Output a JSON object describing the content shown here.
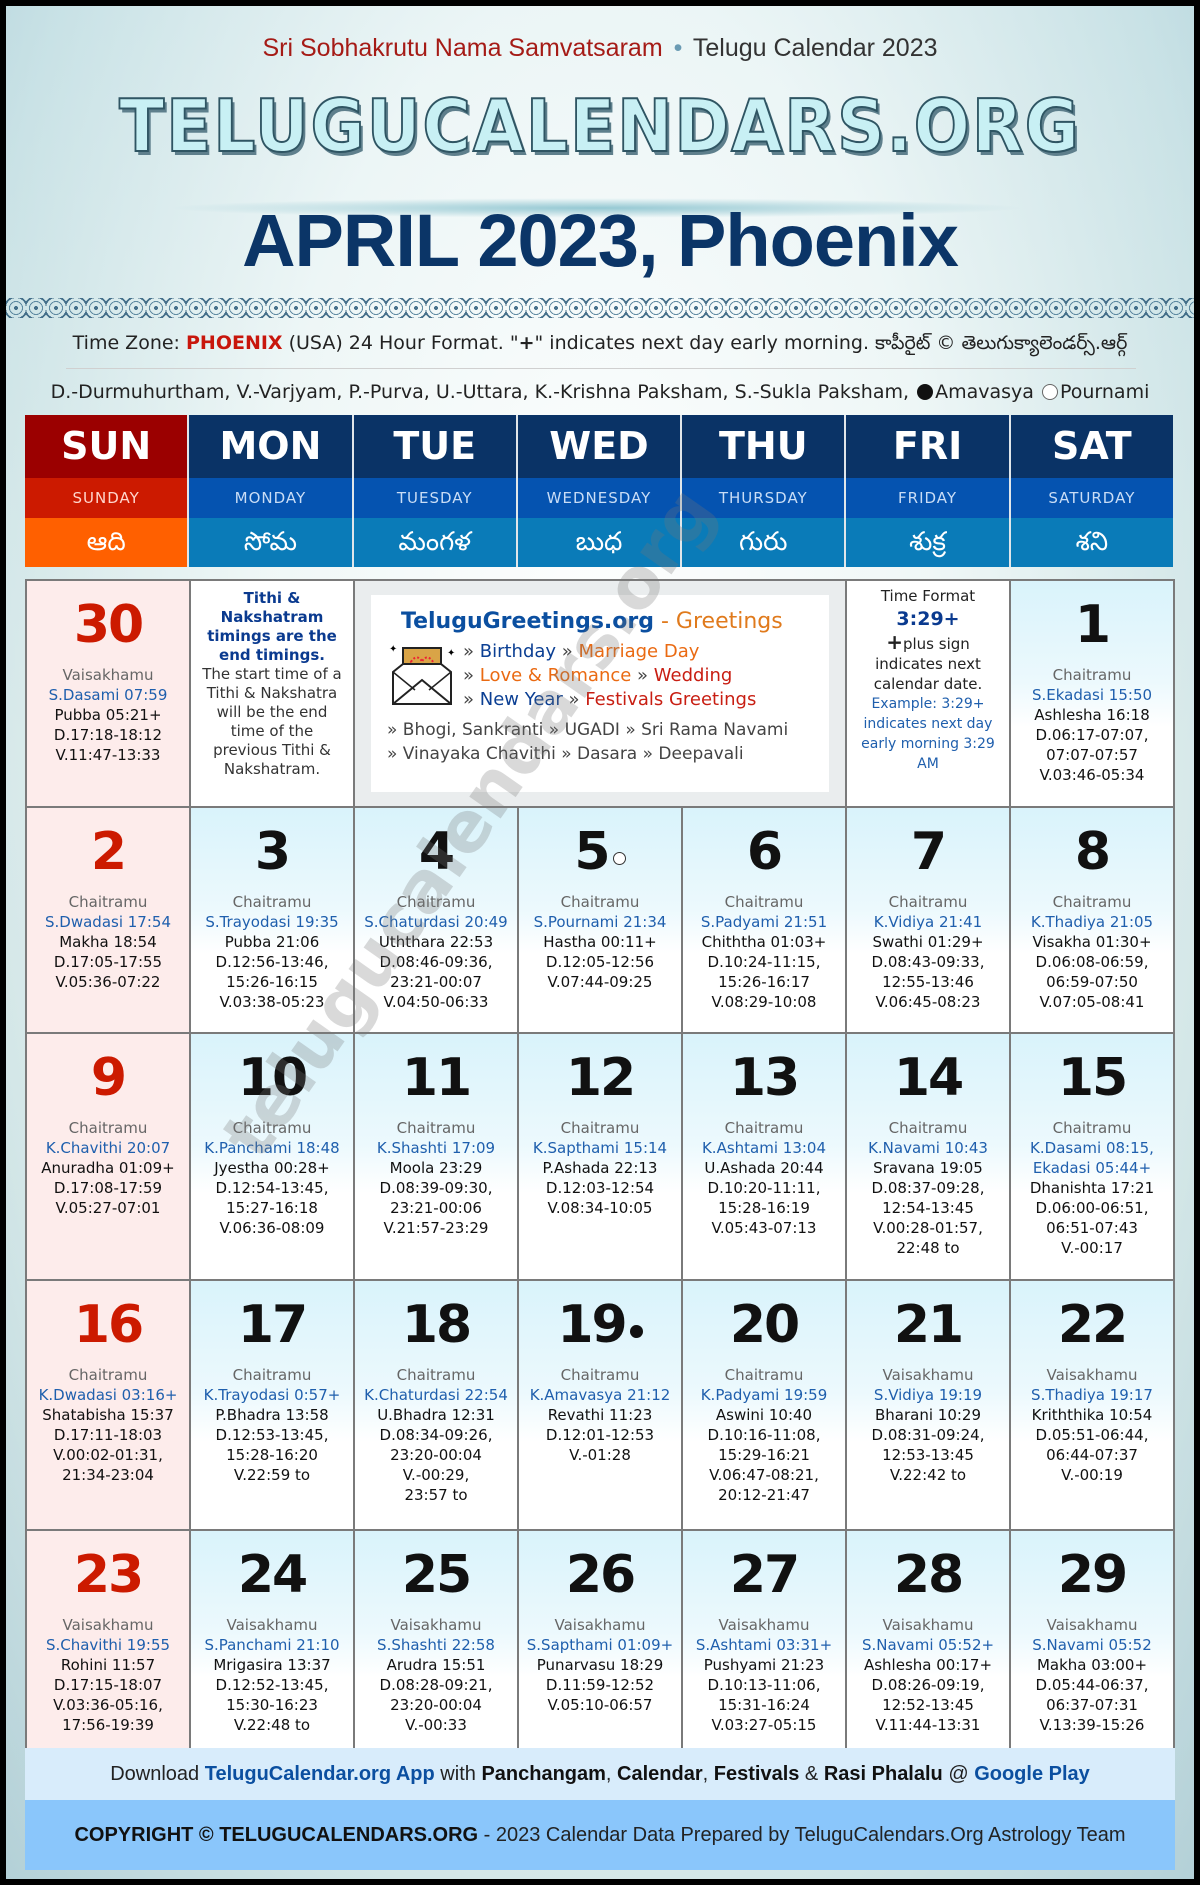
{
  "header": {
    "samvatsaram": "Sri Sobhakrutu Nama Samvatsaram",
    "separator": "•",
    "calendar_year_label": "Telugu Calendar 2023",
    "logo": "TELUGUCALENDARS.ORG",
    "title": "APRIL 2023, Phoenix"
  },
  "timezone": {
    "prefix": "Time Zone: ",
    "city": "PHOENIX",
    "suffix_1": " (USA) 24 Hour Format. \"",
    "plus": "+",
    "suffix_2": "\" indicates next day early morning. కాపీరైట్ © తెలుగుక్యాలెండర్స్.ఆర్గ్"
  },
  "legend": {
    "text": "D.-Durmuhurtham, V.-Varjyam, P.-Purva, U.-Uttara, K.-Krishna Paksham, S.-Sukla Paksham,",
    "amavasya": "Amavasya",
    "pournami": "Pournami"
  },
  "weekdays": [
    {
      "abbr": "SUN",
      "full": "SUNDAY",
      "telugu": "ఆది"
    },
    {
      "abbr": "MON",
      "full": "MONDAY",
      "telugu": "సోమ"
    },
    {
      "abbr": "TUE",
      "full": "TUESDAY",
      "telugu": "మంగళ"
    },
    {
      "abbr": "WED",
      "full": "WEDNESDAY",
      "telugu": "బుధ"
    },
    {
      "abbr": "THU",
      "full": "THURSDAY",
      "telugu": "గురు"
    },
    {
      "abbr": "FRI",
      "full": "FRIDAY",
      "telugu": "శుక్ర"
    },
    {
      "abbr": "SAT",
      "full": "SATURDAY",
      "telugu": "శని"
    }
  ],
  "notes": {
    "tithi_note_bold": "Tithi & Nakshatram timings are the end timings.",
    "tithi_note_text": "The start time of a Tithi & Nakshatra will be the end time of the previous Tithi & Nakshatram.",
    "time_format_title": "Time Format",
    "time_format_example": "3:29+",
    "plus_symbol": "+",
    "plus_text": "plus sign indicates next calendar date.",
    "example_text": "Example: 3:29+ indicates next day early morning 3:29 AM"
  },
  "promo": {
    "site": "TeluguGreetings.org",
    "site_suffix": " - Greetings",
    "links_row1": [
      {
        "t": "» ",
        "c": "g"
      },
      {
        "t": "Birthday",
        "c": "b"
      },
      {
        "t": " » ",
        "c": "g"
      },
      {
        "t": "Marriage Day",
        "c": "o"
      }
    ],
    "links_row2": [
      {
        "t": "» ",
        "c": "g"
      },
      {
        "t": "Love & Romance",
        "c": "o"
      },
      {
        "t": " » ",
        "c": "g"
      },
      {
        "t": "Wedding",
        "c": "r"
      }
    ],
    "links_row3": [
      {
        "t": "» ",
        "c": "g"
      },
      {
        "t": "New Year",
        "c": "b"
      },
      {
        "t": " » ",
        "c": "g"
      },
      {
        "t": "Festivals Greetings",
        "c": "r"
      }
    ],
    "festivals_1": "» Bhogi, Sankranti » UGADI » Sri Rama Navami",
    "festivals_2": "» Vinayaka Chavithi » Dasara » Deepavali"
  },
  "days": [
    {
      "day": "30",
      "sunday": true,
      "month": "Vaisakhamu",
      "tithi": [
        "S.Dasami 07:59"
      ],
      "lines": [
        "Pubba 05:21+",
        "D.17:18-18:12",
        "V.11:47-13:33"
      ]
    },
    {
      "day": "1",
      "month": "Chaitramu",
      "tithi": [
        "S.Ekadasi 15:50"
      ],
      "lines": [
        "Ashlesha 16:18",
        "D.06:17-07:07,",
        "07:07-07:57",
        "V.03:46-05:34"
      ]
    },
    {
      "day": "2",
      "sunday": true,
      "month": "Chaitramu",
      "tithi": [
        "S.Dwadasi 17:54"
      ],
      "lines": [
        "Makha 18:54",
        "D.17:05-17:55",
        "V.05:36-07:22"
      ]
    },
    {
      "day": "3",
      "month": "Chaitramu",
      "tithi": [
        "S.Trayodasi 19:35"
      ],
      "lines": [
        "Pubba 21:06",
        "D.12:56-13:46,",
        "15:26-16:15",
        "V.03:38-05:23"
      ]
    },
    {
      "day": "4",
      "month": "Chaitramu",
      "tithi": [
        "S.Chaturdasi 20:49"
      ],
      "lines": [
        "Uththara 22:53",
        "D.08:46-09:36,",
        "23:21-00:07",
        "V.04:50-06:33"
      ]
    },
    {
      "day": "5",
      "moon": "pournami",
      "month": "Chaitramu",
      "tithi": [
        "S.Pournami 21:34"
      ],
      "lines": [
        "Hastha 00:11+",
        "D.12:05-12:56",
        "V.07:44-09:25"
      ]
    },
    {
      "day": "6",
      "month": "Chaitramu",
      "tithi": [
        "S.Padyami 21:51"
      ],
      "lines": [
        "Chiththa 01:03+",
        "D.10:24-11:15,",
        "15:26-16:17",
        "V.08:29-10:08"
      ]
    },
    {
      "day": "7",
      "month": "Chaitramu",
      "tithi": [
        "K.Vidiya 21:41"
      ],
      "lines": [
        "Swathi 01:29+",
        "D.08:43-09:33,",
        "12:55-13:46",
        "V.06:45-08:23"
      ]
    },
    {
      "day": "8",
      "month": "Chaitramu",
      "tithi": [
        "K.Thadiya 21:05"
      ],
      "lines": [
        "Visakha 01:30+",
        "D.06:08-06:59,",
        "06:59-07:50",
        "V.07:05-08:41"
      ]
    },
    {
      "day": "9",
      "sunday": true,
      "month": "Chaitramu",
      "tithi": [
        "K.Chavithi 20:07"
      ],
      "lines": [
        "Anuradha 01:09+",
        "D.17:08-17:59",
        "V.05:27-07:01"
      ]
    },
    {
      "day": "10",
      "month": "Chaitramu",
      "tithi": [
        "K.Panchami 18:48"
      ],
      "lines": [
        "Jyestha 00:28+",
        "D.12:54-13:45,",
        "15:27-16:18",
        "V.06:36-08:09"
      ]
    },
    {
      "day": "11",
      "month": "Chaitramu",
      "tithi": [
        "K.Shashti 17:09"
      ],
      "lines": [
        "Moola 23:29",
        "D.08:39-09:30,",
        "23:21-00:06",
        "V.21:57-23:29"
      ]
    },
    {
      "day": "12",
      "month": "Chaitramu",
      "tithi": [
        "K.Sapthami 15:14"
      ],
      "lines": [
        "P.Ashada 22:13",
        "D.12:03-12:54",
        "V.08:34-10:05"
      ]
    },
    {
      "day": "13",
      "month": "Chaitramu",
      "tithi": [
        "K.Ashtami 13:04"
      ],
      "lines": [
        "U.Ashada 20:44",
        "D.10:20-11:11,",
        "15:28-16:19",
        "V.05:43-07:13"
      ]
    },
    {
      "day": "14",
      "month": "Chaitramu",
      "tithi": [
        "K.Navami 10:43"
      ],
      "lines": [
        "Sravana 19:05",
        "D.08:37-09:28,",
        "12:54-13:45",
        "V.00:28-01:57,",
        "22:48 to"
      ]
    },
    {
      "day": "15",
      "month": "Chaitramu",
      "tithi": [
        "K.Dasami 08:15,",
        "Ekadasi 05:44+"
      ],
      "lines": [
        "Dhanishta 17:21",
        "D.06:00-06:51,",
        "06:51-07:43",
        "V.-00:17"
      ]
    },
    {
      "day": "16",
      "sunday": true,
      "month": "Chaitramu",
      "tithi": [
        "K.Dwadasi 03:16+"
      ],
      "lines": [
        "Shatabisha 15:37",
        "D.17:11-18:03",
        "V.00:02-01:31,",
        "21:34-23:04"
      ]
    },
    {
      "day": "17",
      "month": "Chaitramu",
      "tithi": [
        "K.Trayodasi 0:57+"
      ],
      "lines": [
        "P.Bhadra 13:58",
        "D.12:53-13:45,",
        "15:28-16:20",
        "V.22:59 to"
      ]
    },
    {
      "day": "18",
      "month": "Chaitramu",
      "tithi": [
        "K.Chaturdasi 22:54"
      ],
      "lines": [
        "U.Bhadra 12:31",
        "D.08:34-09:26,",
        "23:20-00:04",
        "V.-00:29,",
        "23:57 to"
      ]
    },
    {
      "day": "19",
      "moon": "amavasya",
      "month": "Chaitramu",
      "tithi": [
        "K.Amavasya 21:12"
      ],
      "lines": [
        "Revathi 11:23",
        "D.12:01-12:53",
        "V.-01:28"
      ]
    },
    {
      "day": "20",
      "month": "Chaitramu",
      "tithi": [
        "K.Padyami 19:59"
      ],
      "lines": [
        "Aswini 10:40",
        "D.10:16-11:08,",
        "15:29-16:21",
        "V.06:47-08:21,",
        "20:12-21:47"
      ]
    },
    {
      "day": "21",
      "month": "Vaisakhamu",
      "tithi": [
        "S.Vidiya 19:19"
      ],
      "lines": [
        "Bharani 10:29",
        "D.08:31-09:24,",
        "12:53-13:45",
        "V.22:42 to"
      ]
    },
    {
      "day": "22",
      "month": "Vaisakhamu",
      "tithi": [
        "S.Thadiya 19:17"
      ],
      "lines": [
        "Kriththika 10:54",
        "D.05:51-06:44,",
        "06:44-07:37",
        "V.-00:19"
      ]
    },
    {
      "day": "23",
      "sunday": true,
      "month": "Vaisakhamu",
      "tithi": [
        "S.Chavithi 19:55"
      ],
      "lines": [
        "Rohini 11:57",
        "D.17:15-18:07",
        "V.03:36-05:16,",
        "17:56-19:39"
      ]
    },
    {
      "day": "24",
      "month": "Vaisakhamu",
      "tithi": [
        "S.Panchami 21:10"
      ],
      "lines": [
        "Mrigasira 13:37",
        "D.12:52-13:45,",
        "15:30-16:23",
        "V.22:48 to"
      ]
    },
    {
      "day": "25",
      "month": "Vaisakhamu",
      "tithi": [
        "S.Shashti 22:58"
      ],
      "lines": [
        "Arudra 15:51",
        "D.08:28-09:21,",
        "23:20-00:04",
        "V.-00:33"
      ]
    },
    {
      "day": "26",
      "month": "Vaisakhamu",
      "tithi": [
        "S.Sapthami 01:09+"
      ],
      "lines": [
        "Punarvasu 18:29",
        "D.11:59-12:52",
        "V.05:10-06:57"
      ]
    },
    {
      "day": "27",
      "month": "Vaisakhamu",
      "tithi": [
        "S.Ashtami 03:31+"
      ],
      "lines": [
        "Pushyami 21:23",
        "D.10:13-11:06,",
        "15:31-16:24",
        "V.03:27-05:15"
      ]
    },
    {
      "day": "28",
      "month": "Vaisakhamu",
      "tithi": [
        "S.Navami 05:52+"
      ],
      "lines": [
        "Ashlesha 00:17+",
        "D.08:26-09:19,",
        "12:52-13:45",
        "V.11:44-13:31"
      ]
    },
    {
      "day": "29",
      "month": "Vaisakhamu",
      "tithi": [
        "S.Navami 05:52"
      ],
      "lines": [
        "Makha 03:00+",
        "D.05:44-06:37,",
        "06:37-07:31",
        "V.13:39-15:26"
      ]
    }
  ],
  "watermark": "telugucalendars.org",
  "footer": {
    "download_prefix": "Download ",
    "app_link": "TeluguCalendar.org App",
    "with": " with ",
    "panchangam": "Panchangam",
    "comma1": ", ",
    "calendar": "Calendar",
    "comma2": ", ",
    "festivals": "Festivals",
    "amp": " & ",
    "rasi": "Rasi Phalalu",
    "at": " @ ",
    "google_play": "Google Play",
    "copyright_bold": "COPYRIGHT © TELUGUCALENDARS.ORG",
    "copyright_rest": " - 2023 Calendar Data Prepared by TeluguCalendars.Org Astrology Team"
  }
}
